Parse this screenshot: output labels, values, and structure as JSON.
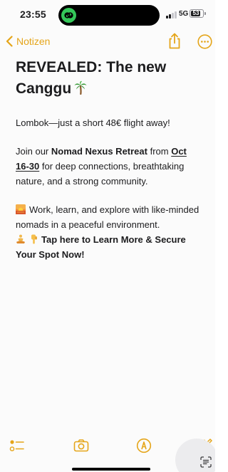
{
  "status_bar": {
    "time": "23:55",
    "network": "5G",
    "battery": "53",
    "island_app_icon": "link-rings-icon"
  },
  "nav": {
    "back_label": "Notizen",
    "share_icon": "share-icon",
    "more_icon": "ellipsis-circle-icon"
  },
  "colors": {
    "accent": "#e5a519",
    "text": "#1c1c1e",
    "background": "#fbfbfb"
  },
  "note": {
    "title": "REVEALED: The new Canggu",
    "title_emoji": "palm-tree-icon",
    "line1": "Lombok—just a short 48€ flight away!",
    "p2_part1": "Join our ",
    "p2_bold": "Nomad Nexus Retreat",
    "p2_part2": " from ",
    "p2_date": "Oct 16-30",
    "p2_part3": " for deep connections, breathtaking nature, and a strong community.",
    "p3_emoji": "sunrise-icon",
    "p3_text": "Work, learn, and explore with like-minded nomads in a peaceful environment.",
    "p3_emoji2": "meditation-icon",
    "p3_emoji3": "pointing-down-icon",
    "cta": "Tap here to Learn More & Secure Your Spot Now!"
  },
  "toolbar": {
    "checklist_icon": "checklist-icon",
    "camera_icon": "camera-icon",
    "markup_icon": "markup-pen-icon",
    "compose_icon": "compose-icon",
    "scan_icon": "text-scan-icon"
  }
}
